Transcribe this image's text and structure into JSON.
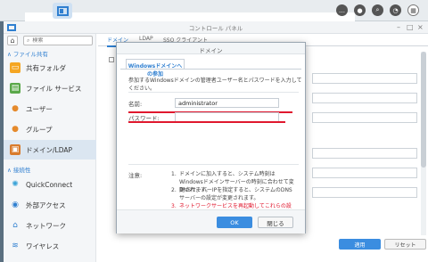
{
  "window": {
    "title": "コントロール パネル",
    "minimize": "–",
    "maximize": "□",
    "close": "×"
  },
  "sidebar": {
    "search_placeholder": "検索",
    "section_file": "ファイル共有",
    "section_connect": "接続性",
    "items": [
      {
        "label": "共有フォルダ",
        "icon": "folder-icon"
      },
      {
        "label": "ファイル サービス",
        "icon": "file-services-icon"
      },
      {
        "label": "ユーザー",
        "icon": "user-icon"
      },
      {
        "label": "グループ",
        "icon": "group-icon"
      },
      {
        "label": "ドメイン/LDAP",
        "icon": "domain-icon",
        "selected": true
      },
      {
        "label": "QuickConnect",
        "icon": "quickconnect-icon"
      },
      {
        "label": "外部アクセス",
        "icon": "globe-icon"
      },
      {
        "label": "ネットワーク",
        "icon": "network-icon"
      },
      {
        "label": "ワイヤレス",
        "icon": "wifi-icon"
      }
    ]
  },
  "tabs": [
    {
      "label": "ドメイン",
      "active": true
    },
    {
      "label": "LDAP"
    },
    {
      "label": "SSO クライアント"
    }
  ],
  "buttons": {
    "apply": "適用",
    "reset": "リセット"
  },
  "dialog": {
    "title": "ドメイン",
    "tab": "Windowsドメインへの参加",
    "description": "参加するWindowsドメインの管理者ユーザー名とパスワードを入力してください。",
    "name_label": "名前:",
    "name_value": "administrator",
    "password_label": "パスワード:",
    "password_value": "",
    "notes_label": "注意:",
    "notes": [
      {
        "num": "1.",
        "text": "ドメインに加入すると、システム時刻はWindowsドメインサーバーの時刻に合わせて変更されます。"
      },
      {
        "num": "2.",
        "text": "DNSサーバーIPを指定すると、システムのDNSサーバーの設定が変更されます。"
      },
      {
        "num": "3.",
        "text": "ネットワークサービスを再起動してこれらの設定を適用します。",
        "warning": true
      }
    ],
    "ok": "OK",
    "close": "閉じる"
  },
  "colors": {
    "accent": "#2f7fd0",
    "primary_button": "#3b8de0",
    "warning": "#e0182e",
    "selected_nav": "#dbe6f1"
  }
}
